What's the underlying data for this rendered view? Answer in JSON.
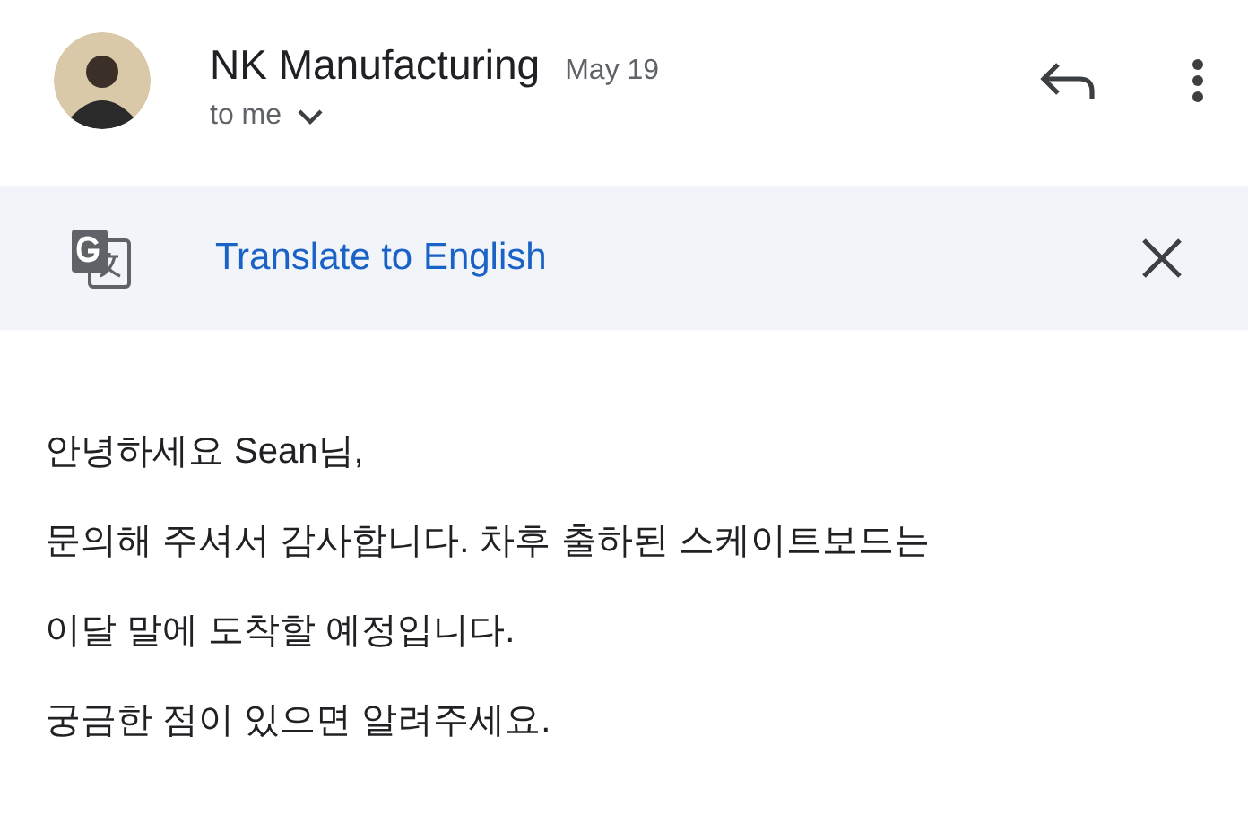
{
  "header": {
    "sender": "NK Manufacturing",
    "date": "May 19",
    "recipient": "to me"
  },
  "translate_bar": {
    "label": "Translate to English"
  },
  "message": {
    "paragraphs": [
      [
        "안녕하세요 Sean님,"
      ],
      [
        "문의해 주셔서 감사합니다. 차후 출하된 스케이트보드는",
        "이달 말에 도착할 예정입니다."
      ],
      [
        "궁금한 점이 있으면 알려주세요."
      ]
    ]
  }
}
